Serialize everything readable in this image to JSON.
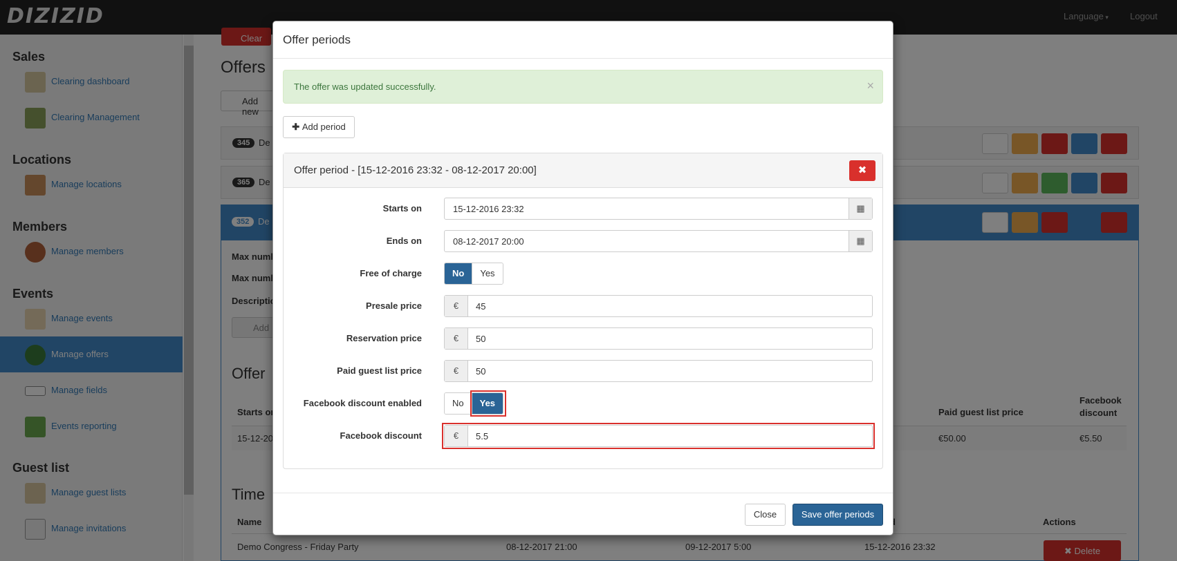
{
  "navbar": {
    "brand": "DIZIZID",
    "language": "Language",
    "logout": "Logout"
  },
  "sidebar": {
    "sections": [
      {
        "title": "Sales",
        "items": [
          "Clearing dashboard",
          "Clearing Management"
        ]
      },
      {
        "title": "Locations",
        "items": [
          "Manage locations"
        ]
      },
      {
        "title": "Members",
        "items": [
          "Manage members"
        ]
      },
      {
        "title": "Events",
        "items": [
          "Manage events",
          "Manage offers",
          "Manage fields",
          "Events reporting"
        ]
      },
      {
        "title": "Guest list",
        "items": [
          "Manage guest lists",
          "Manage invitations"
        ]
      }
    ],
    "active": "Manage offers"
  },
  "background": {
    "clear_btn": "Clear",
    "page_title": "Offers",
    "add_new": "Add new",
    "rows": [
      {
        "id": "345",
        "name": "De"
      },
      {
        "id": "365",
        "name": "De"
      },
      {
        "id": "352",
        "name": "De"
      }
    ],
    "detail_labels": [
      "Max numb",
      "Max numb",
      "Descriptio"
    ],
    "add_btn": "Add",
    "section_offer": "Offer",
    "offer_table": {
      "col_starts": "Starts on",
      "col_paid": "Paid guest list price",
      "col_fb": "Facebook discount",
      "row_start": "15-12-20",
      "row_paid": "€50.00",
      "row_fb": "€5.50"
    },
    "section_time": "Time",
    "time_table": {
      "col_name": "Name",
      "col_actions": "Actions",
      "col_d": "d",
      "row_name": "Demo Congress - Friday Party",
      "row_a": "08-12-2017 21:00",
      "row_b": "09-12-2017 5:00",
      "row_c": "15-12-2016 23:32",
      "delete": "Delete"
    }
  },
  "modal": {
    "title": "Offer periods",
    "alert": "The offer was updated successfully.",
    "add_period": "Add period",
    "period_title": "Offer period - [15-12-2016 23:32 - 08-12-2017 20:00]",
    "fields": {
      "starts_on": {
        "label": "Starts on",
        "value": "15-12-2016 23:32"
      },
      "ends_on": {
        "label": "Ends on",
        "value": "08-12-2017 20:00"
      },
      "free_of_charge": {
        "label": "Free of charge",
        "no": "No",
        "yes": "Yes",
        "selected": "No"
      },
      "presale_price": {
        "label": "Presale price",
        "currency": "€",
        "value": "45"
      },
      "reservation_price": {
        "label": "Reservation price",
        "currency": "€",
        "value": "50"
      },
      "paid_guest_list_price": {
        "label": "Paid guest list price",
        "currency": "€",
        "value": "50"
      },
      "facebook_discount_enabled": {
        "label": "Facebook discount enabled",
        "no": "No",
        "yes": "Yes",
        "selected": "Yes"
      },
      "facebook_discount": {
        "label": "Facebook discount",
        "currency": "€",
        "value": "5.5"
      }
    },
    "close": "Close",
    "save": "Save offer periods"
  },
  "colors": {
    "primary": "#2a6496",
    "danger": "#d9302c",
    "success_bg": "#dff0d8",
    "warning": "#f0ad4e",
    "green": "#5cb85c"
  }
}
